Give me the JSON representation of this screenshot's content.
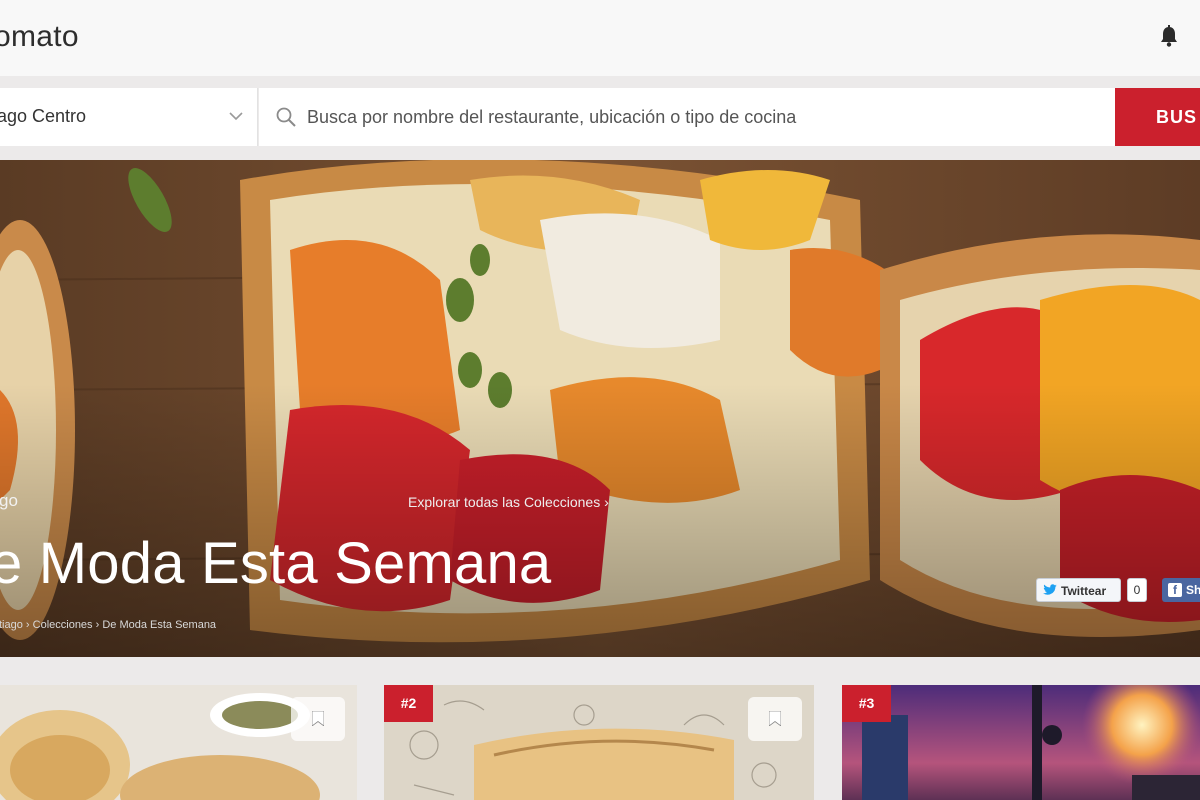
{
  "header": {
    "logo_text": "omato",
    "bell_icon": "bell-icon"
  },
  "search": {
    "location_value": "tiago Centro",
    "placeholder": "Busca por nombre del restaurante, ubicación o tipo de cocina",
    "button_label": "BUS"
  },
  "hero": {
    "city_label": "go",
    "explore_link": "Explorar todas las Colecciones ›",
    "title": "e Moda Esta Semana",
    "breadcrumb": "tiago › Colecciones › De Moda Esta Semana",
    "share": {
      "twitter_label": "Twittear",
      "twitter_count": "0",
      "facebook_label": "Sh"
    }
  },
  "cards": [
    {
      "rank": ""
    },
    {
      "rank": "#2"
    },
    {
      "rank": "#3"
    }
  ],
  "colors": {
    "accent": "#cb202d",
    "twitter": "#1da1f2",
    "facebook": "#4a66a0"
  }
}
